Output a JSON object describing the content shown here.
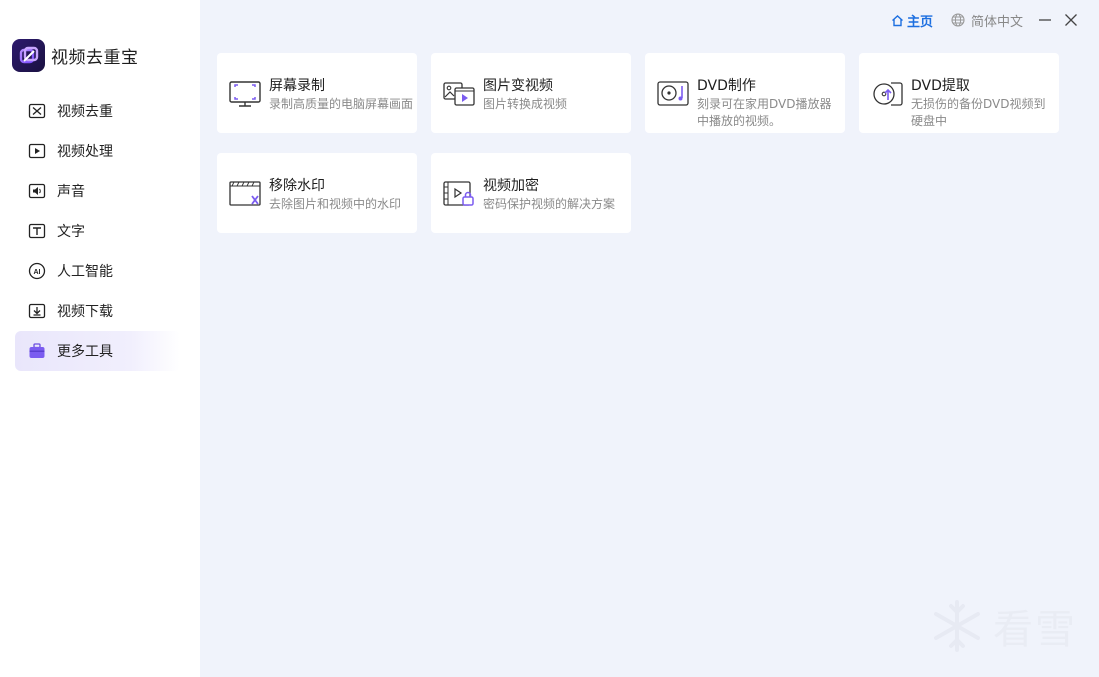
{
  "app": {
    "name": "视频去重宝"
  },
  "sidebar": {
    "items": [
      {
        "label": "视频去重",
        "icon": "video-dedupe-icon"
      },
      {
        "label": "视频处理",
        "icon": "play-box-icon"
      },
      {
        "label": "声音",
        "icon": "sound-icon"
      },
      {
        "label": "文字",
        "icon": "text-icon"
      },
      {
        "label": "人工智能",
        "icon": "ai-icon"
      },
      {
        "label": "视频下载",
        "icon": "download-icon"
      },
      {
        "label": "更多工具",
        "icon": "toolbox-icon",
        "active": true
      }
    ]
  },
  "topbar": {
    "home_label": "主页",
    "language_label": "简体中文"
  },
  "tools": [
    {
      "title": "屏幕录制",
      "desc": "录制高质量的电脑屏幕画面",
      "icon": "screen-record-icon"
    },
    {
      "title": "图片变视频",
      "desc": "图片转换成视频",
      "icon": "image-to-video-icon"
    },
    {
      "title": "DVD制作",
      "desc": "刻录可在家用DVD播放器中播放的视频。",
      "icon": "dvd-burn-icon"
    },
    {
      "title": "DVD提取",
      "desc": "无损伤的备份DVD视频到硬盘中",
      "icon": "dvd-extract-icon"
    },
    {
      "title": "移除水印",
      "desc": "去除图片和视频中的水印",
      "icon": "remove-watermark-icon"
    },
    {
      "title": "视频加密",
      "desc": "密码保护视频的解决方案",
      "icon": "video-encrypt-icon"
    }
  ],
  "watermark": {
    "text": "看雪"
  },
  "colors": {
    "accent": "#1d6fe0",
    "purple": "#7b5cf0",
    "background": "#f0f3fb"
  }
}
